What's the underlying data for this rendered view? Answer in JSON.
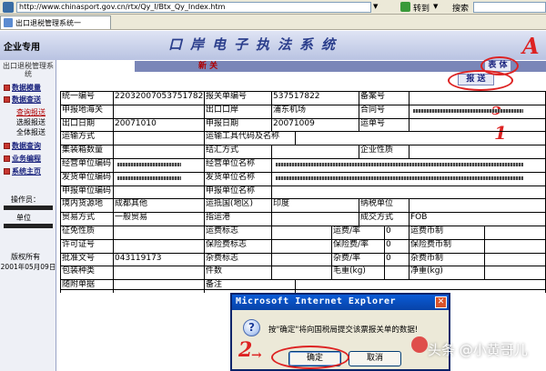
{
  "browser": {
    "url": "http://www.chinasport.gov.cn/rtx/Qy_I/Btx_Qy_Index.htm",
    "go_label": "转到",
    "search_label": "搜索",
    "tab_label": "出口退税管理系统一"
  },
  "header": {
    "brand": "企业专用",
    "system_title": "口岸电子执法系统"
  },
  "sidebar": {
    "section_title": "出口退税管理系统",
    "items": [
      {
        "label": "数据模量"
      },
      {
        "label": "数据查送"
      },
      {
        "label": "数据查询"
      },
      {
        "label": "业务编程"
      },
      {
        "label": "系统主页"
      }
    ],
    "sub_items": [
      {
        "label": "查询报送",
        "active": true
      },
      {
        "label": "选报报送",
        "active": false
      },
      {
        "label": "全体报送",
        "active": false
      }
    ],
    "operator_label": "操作员：",
    "unit_label": "单位",
    "copyright": "版权所有",
    "date": "2001年05月09日"
  },
  "content": {
    "section_title": "新  关",
    "btn_table": "表 体",
    "btn_report": "报 送",
    "annotation_a": "A",
    "annotation_1": "1",
    "annotation_2": "2"
  },
  "form": {
    "rows": [
      [
        [
          "统一编号",
          "lbl"
        ],
        [
          "220320070537517822",
          "val"
        ],
        [
          "报关单编号",
          "lbl"
        ],
        [
          "537517822",
          "val"
        ],
        [
          "备案号",
          "lbl"
        ],
        [
          "",
          "val"
        ]
      ],
      [
        [
          "申报地海关",
          "lbl"
        ],
        [
          "",
          "val"
        ],
        [
          "出口口岸",
          "lbl"
        ],
        [
          "浦东机场",
          "val"
        ],
        [
          "合同号",
          "lbl"
        ],
        [
          "",
          "redact"
        ]
      ],
      [
        [
          "出口日期",
          "lbl"
        ],
        [
          "20071010",
          "val"
        ],
        [
          "申报日期",
          "lbl"
        ],
        [
          "20071009",
          "val"
        ],
        [
          "运单号",
          "lbl"
        ],
        [
          "",
          "val"
        ]
      ],
      [
        [
          "运输方式",
          "lbl"
        ],
        [
          "",
          "val"
        ],
        [
          "运输工具代码及名称",
          "lbl"
        ],
        [
          "",
          "val"
        ]
      ],
      [
        [
          "集装箱数量",
          "lbl"
        ],
        [
          "",
          "val"
        ],
        [
          "结汇方式",
          "lbl"
        ],
        [
          "",
          "val"
        ],
        [
          "企业性质",
          "lbl"
        ],
        [
          "",
          "val"
        ]
      ],
      [
        [
          "经营单位编码",
          "lbl"
        ],
        [
          "",
          "redact"
        ],
        [
          "经营单位名称",
          "lbl"
        ],
        [
          "",
          "redact"
        ]
      ],
      [
        [
          "发货单位编码",
          "lbl"
        ],
        [
          "",
          "redact"
        ],
        [
          "发货单位名称",
          "lbl"
        ],
        [
          "",
          "redact"
        ]
      ],
      [
        [
          "申报单位编码",
          "lbl"
        ],
        [
          "",
          "val"
        ],
        [
          "申报单位名称",
          "lbl"
        ],
        [
          "",
          "val"
        ]
      ],
      [
        [
          "境内货源地",
          "lbl"
        ],
        [
          "成都其他",
          "val"
        ],
        [
          "运抵国(地区)",
          "lbl"
        ],
        [
          "印度",
          "val"
        ],
        [
          "纳税单位",
          "lbl"
        ],
        [
          "",
          "val"
        ]
      ],
      [
        [
          "贸易方式",
          "lbl"
        ],
        [
          "一般贸易",
          "val"
        ],
        [
          "指运港",
          "lbl"
        ],
        [
          "",
          "val"
        ],
        [
          "成交方式",
          "lbl"
        ],
        [
          "FOB",
          "val"
        ]
      ],
      [
        [
          "征免性质",
          "lbl"
        ],
        [
          "",
          "val"
        ],
        [
          "运费标志",
          "lbl"
        ],
        [
          "",
          "val"
        ],
        [
          "运费/率",
          "lbl"
        ],
        [
          "0",
          "val"
        ],
        [
          "运费币制",
          "lbl"
        ],
        [
          "",
          "val"
        ]
      ],
      [
        [
          "许可证号",
          "lbl"
        ],
        [
          "",
          "val"
        ],
        [
          "保险费标志",
          "lbl"
        ],
        [
          "",
          "val"
        ],
        [
          "保险费/率",
          "lbl"
        ],
        [
          "0",
          "val"
        ],
        [
          "保险费币制",
          "lbl"
        ],
        [
          "",
          "val"
        ]
      ],
      [
        [
          "批准文号",
          "lbl"
        ],
        [
          "043119173",
          "val"
        ],
        [
          "杂费标志",
          "lbl"
        ],
        [
          "",
          "val"
        ],
        [
          "杂费/率",
          "lbl"
        ],
        [
          "0",
          "val"
        ],
        [
          "杂费币制",
          "lbl"
        ],
        [
          "",
          "val"
        ]
      ],
      [
        [
          "包装种类",
          "lbl"
        ],
        [
          "",
          "val"
        ],
        [
          "件数",
          "lbl"
        ],
        [
          "",
          "val"
        ],
        [
          "毛重(kg)",
          "lbl"
        ],
        [
          "",
          "val"
        ],
        [
          "净重(kg)",
          "lbl"
        ],
        [
          "",
          "val"
        ]
      ],
      [
        [
          "随附单据",
          "lbl"
        ],
        [
          "",
          "val"
        ],
        [
          "备注",
          "lbl"
        ],
        [
          "",
          "val"
        ]
      ]
    ]
  },
  "dialog": {
    "title": "Microsoft Internet Explorer",
    "close": "✕",
    "icon": "?",
    "message": "按\"确定\"将向国税局提交该票报关单的数据!",
    "ok_label": "确定",
    "cancel_label": "取消"
  },
  "watermark": "头条 @小黄哥儿"
}
